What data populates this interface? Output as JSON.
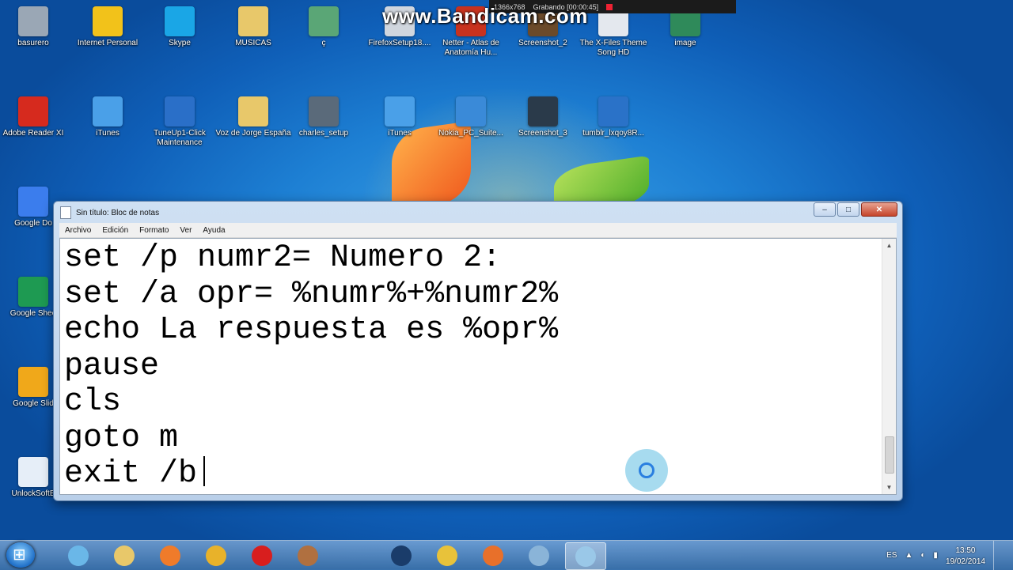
{
  "desktop": {
    "icons": [
      {
        "label": "basurero",
        "icon": "recycle-bin-icon",
        "color": "#9aa7b5"
      },
      {
        "label": "Internet Personal",
        "icon": "personal-icon",
        "color": "#f2c21a"
      },
      {
        "label": "Skype",
        "icon": "skype-icon",
        "color": "#1aa6e6"
      },
      {
        "label": "MUSICAS",
        "icon": "folder-icon",
        "color": "#e8c86a"
      },
      {
        "label": "ç",
        "icon": "image-file-icon",
        "color": "#5aa676"
      },
      {
        "label": "FirefoxSetup18....",
        "icon": "installer-icon",
        "color": "#d0d6de"
      },
      {
        "label": "Netter - Atlas de Anatomía Hu...",
        "icon": "pdf-icon",
        "color": "#c8321e"
      },
      {
        "label": "Screenshot_2",
        "icon": "screenshot-icon",
        "color": "#6b4a2a"
      },
      {
        "label": "The X-Files Theme Song HD",
        "icon": "video-file-icon",
        "color": "#e4e8ee"
      },
      {
        "label": "image",
        "icon": "image-icon",
        "color": "#2f8a5a"
      },
      {
        "label": "Adobe Reader XI",
        "icon": "adobe-reader-icon",
        "color": "#d62a1e"
      },
      {
        "label": "iTunes",
        "icon": "itunes-icon",
        "color": "#4aa0e8"
      },
      {
        "label": "TuneUp1-Click Maintenance",
        "icon": "tuneup-icon",
        "color": "#2a6fc8"
      },
      {
        "label": "Voz de Jorge España",
        "icon": "folder-icon",
        "color": "#e8c86a"
      },
      {
        "label": "charles_setup",
        "icon": "setup-icon",
        "color": "#5a6a7a"
      },
      {
        "label": "iTunes",
        "icon": "itunes-icon",
        "color": "#4aa0e8"
      },
      {
        "label": "Nokia_PC_Suite...",
        "icon": "download-icon",
        "color": "#3a8ad8"
      },
      {
        "label": "Screenshot_3",
        "icon": "screenshot-icon",
        "color": "#2a3a4a"
      },
      {
        "label": "tumblr_lxqoy8R...",
        "icon": "word-file-icon",
        "color": "#2a72c8"
      },
      {
        "label": "Google Do",
        "icon": "google-docs-icon",
        "color": "#3b7ded"
      },
      {
        "label": "Google Shee",
        "icon": "google-sheets-icon",
        "color": "#1e9a52"
      },
      {
        "label": "Google Slid",
        "icon": "google-slides-icon",
        "color": "#f0a81a"
      },
      {
        "label": "UnlockSoftB",
        "icon": "hfa-icon",
        "color": "#e6eef8"
      }
    ]
  },
  "recording": {
    "watermark": "www.Bandicam.com",
    "resolution": "1366x768",
    "status": "Grabando [00:00:45]"
  },
  "notepad": {
    "title": "Sin título: Bloc de notas",
    "menu": [
      "Archivo",
      "Edición",
      "Formato",
      "Ver",
      "Ayuda"
    ],
    "lines": [
      "set /p numr2= Numero 2:",
      "set /a opr= %numr%+%numr2%",
      "echo La respuesta es %opr%",
      "pause",
      "cls",
      "goto m",
      "exit /b"
    ]
  },
  "taskbar": {
    "items": [
      {
        "name": "explorer",
        "icon": "windows-explorer-icon",
        "color": "#6ab7e8"
      },
      {
        "name": "folder",
        "icon": "folder-icon",
        "color": "#e8c86a"
      },
      {
        "name": "media",
        "icon": "media-player-icon",
        "color": "#ef7b2a"
      },
      {
        "name": "chrome",
        "icon": "chrome-icon",
        "color": "#e8b22a"
      },
      {
        "name": "recorder",
        "icon": "record-icon",
        "color": "#d81e1e"
      },
      {
        "name": "app",
        "icon": "guitar-icon",
        "color": "#b07040"
      },
      {
        "name": "euro",
        "icon": "euro-icon",
        "color": "#1a3c6a"
      },
      {
        "name": "messenger",
        "icon": "messenger-icon",
        "color": "#e8c23a"
      },
      {
        "name": "firefox",
        "icon": "firefox-icon",
        "color": "#e8702a"
      },
      {
        "name": "network",
        "icon": "network-icon",
        "color": "#8ab4d8"
      },
      {
        "name": "notepad",
        "icon": "notepad-icon",
        "color": "#9ac8e8"
      }
    ],
    "active_index": 10,
    "tray": {
      "lang": "ES",
      "time": "13:50",
      "date": "19/02/2014"
    }
  }
}
